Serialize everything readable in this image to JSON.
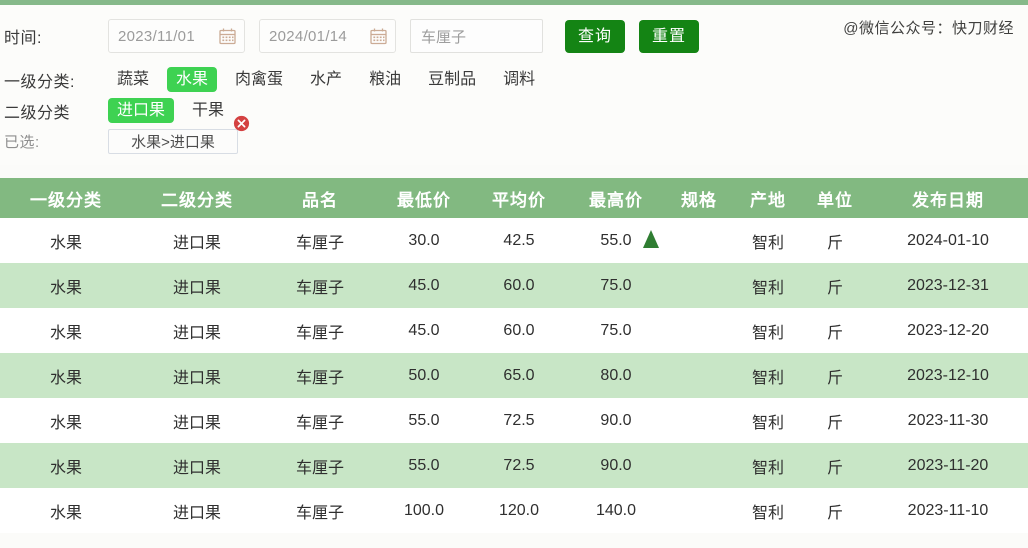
{
  "watermark": "@微信公众号：快刀财经",
  "filters": {
    "time_label": "时间:",
    "date_from": "2023/11/01",
    "date_to": "2024/01/14",
    "keyword": "车厘子",
    "keyword_placeholder": "车厘子",
    "query_button": "查询",
    "reset_button": "重置",
    "cat1_label": "一级分类:",
    "cat1_options": [
      {
        "label": "蔬菜",
        "active": false
      },
      {
        "label": "水果",
        "active": true
      },
      {
        "label": "肉禽蛋",
        "active": false
      },
      {
        "label": "水产",
        "active": false
      },
      {
        "label": "粮油",
        "active": false
      },
      {
        "label": "豆制品",
        "active": false
      },
      {
        "label": "调料",
        "active": false
      }
    ],
    "cat2_label": "二级分类",
    "cat2_options": [
      {
        "label": "进口果",
        "active": true
      },
      {
        "label": "干果",
        "active": false
      }
    ],
    "selected_label": "已选:",
    "selected_tag": "水果>进口果"
  },
  "table": {
    "columns": [
      "一级分类",
      "二级分类",
      "品名",
      "最低价",
      "平均价",
      "最高价",
      "规格",
      "产地",
      "单位",
      "发布日期"
    ],
    "rows": [
      [
        "水果",
        "进口果",
        "车厘子",
        "30.0",
        "42.5",
        "55.0",
        "",
        "智利",
        "斤",
        "2024-01-10"
      ],
      [
        "水果",
        "进口果",
        "车厘子",
        "45.0",
        "60.0",
        "75.0",
        "",
        "智利",
        "斤",
        "2023-12-31"
      ],
      [
        "水果",
        "进口果",
        "车厘子",
        "45.0",
        "60.0",
        "75.0",
        "",
        "智利",
        "斤",
        "2023-12-20"
      ],
      [
        "水果",
        "进口果",
        "车厘子",
        "50.0",
        "65.0",
        "80.0",
        "",
        "智利",
        "斤",
        "2023-12-10"
      ],
      [
        "水果",
        "进口果",
        "车厘子",
        "55.0",
        "72.5",
        "90.0",
        "",
        "智利",
        "斤",
        "2023-11-30"
      ],
      [
        "水果",
        "进口果",
        "车厘子",
        "55.0",
        "72.5",
        "90.0",
        "",
        "智利",
        "斤",
        "2023-11-20"
      ],
      [
        "水果",
        "进口果",
        "车厘子",
        "100.0",
        "120.0",
        "140.0",
        "",
        "智利",
        "斤",
        "2023-11-10"
      ]
    ]
  },
  "colors": {
    "header_green": "#82b981",
    "stripe_green": "#c8e6c6",
    "chip_active": "#3ed252",
    "button_green": "#148414",
    "arrow_green": "#2f7d32"
  }
}
